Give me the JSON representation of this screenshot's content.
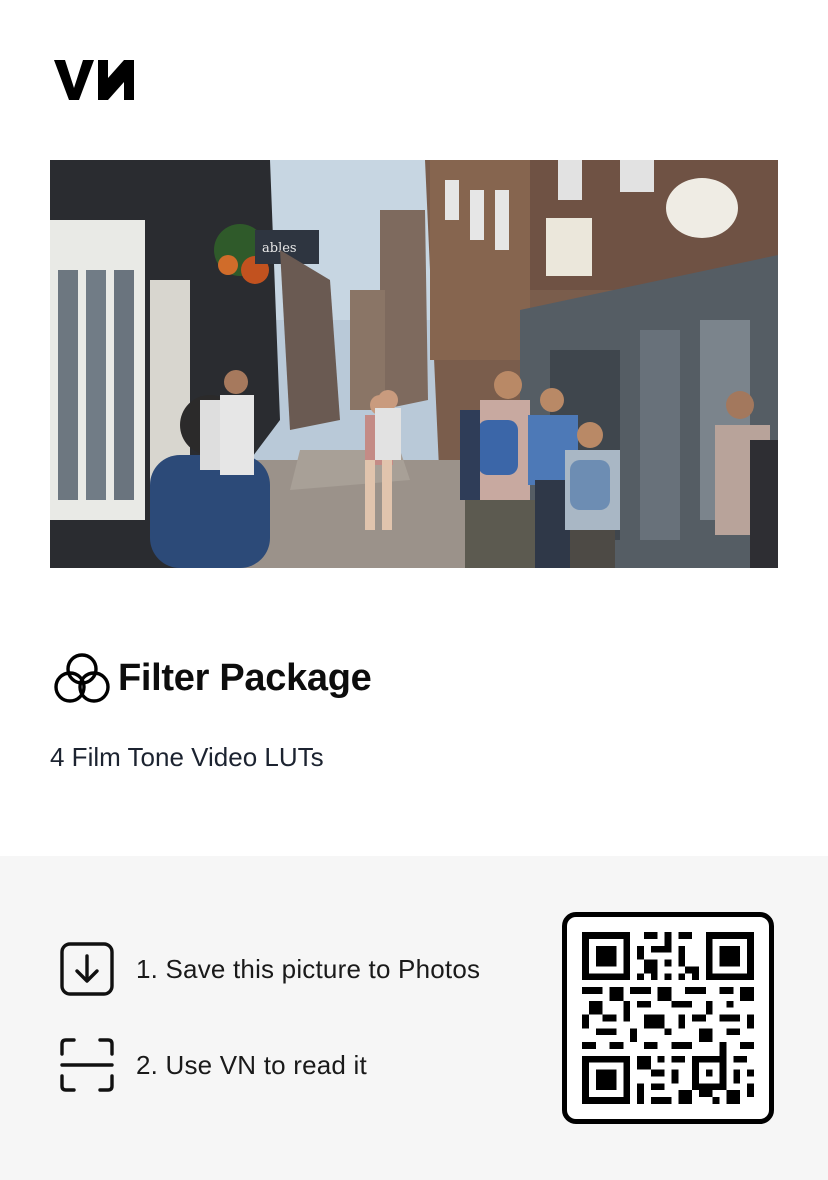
{
  "brand": {
    "logo_text": "VN"
  },
  "hero": {
    "image": "street-scene-photo"
  },
  "package": {
    "icon": "three-circles-filter-icon",
    "title": "Filter Package",
    "subtitle": "4 Film Tone Video LUTs"
  },
  "steps": [
    {
      "icon": "download-icon",
      "label": "1. Save this picture to Photos"
    },
    {
      "icon": "scan-icon",
      "label": "2. Use VN to read it"
    }
  ],
  "qr": {
    "icon": "qr-code"
  },
  "colors": {
    "bottom_panel": "#f6f6f6",
    "text": "#111111",
    "subtitle": "#1c2330"
  }
}
